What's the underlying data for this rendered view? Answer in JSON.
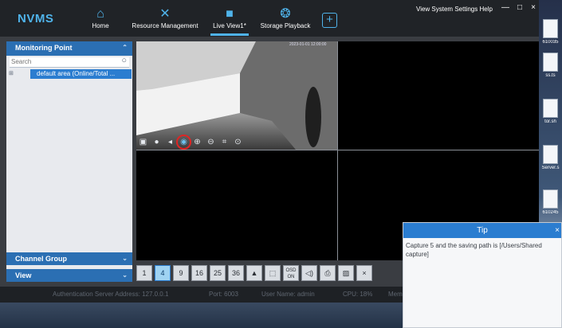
{
  "app": {
    "logo": "NVMS",
    "nav": [
      {
        "label": "Home",
        "icon": "home-icon",
        "glyph": "⌂"
      },
      {
        "label": "Resource Management",
        "icon": "tools-icon",
        "glyph": "✕"
      },
      {
        "label": "Live View1*",
        "icon": "camera-icon",
        "glyph": "■"
      },
      {
        "label": "Storage Playback",
        "icon": "film-reel-icon",
        "glyph": "❂"
      }
    ],
    "add_tab": "+",
    "system_menu": "View System Settings Help",
    "window_buttons": [
      "—",
      "□",
      "×"
    ],
    "accent_color": "#4fb3ea"
  },
  "sidebar": {
    "title": "Monitoring Point",
    "search_placeholder": "Search",
    "tree_item": "default area (Online/Total ...",
    "channel_group": "Channel Group",
    "view": "View",
    "header_color": "#2b6fb3"
  },
  "video": {
    "osd": "2023-01-01 12:00:00",
    "toolbar": [
      {
        "name": "snapshot-folder-icon",
        "glyph": "▣"
      },
      {
        "name": "record-icon",
        "glyph": "●"
      },
      {
        "name": "audio-icon",
        "glyph": "◂"
      },
      {
        "name": "capture-camera-icon",
        "glyph": "◉",
        "highlighted": true
      },
      {
        "name": "zoom-in-icon",
        "glyph": "⊕"
      },
      {
        "name": "zoom-out-icon",
        "glyph": "⊖"
      },
      {
        "name": "fullscreen-icon",
        "glyph": "⌗"
      },
      {
        "name": "location-pin-icon",
        "glyph": "⊙"
      }
    ]
  },
  "layout_buttons": [
    {
      "label": "1",
      "active": false
    },
    {
      "label": "4",
      "active": true
    },
    {
      "label": "9",
      "active": false
    },
    {
      "label": "16",
      "active": false
    },
    {
      "label": "25",
      "active": false
    },
    {
      "label": "36",
      "active": false
    },
    {
      "label": "▲",
      "active": false
    },
    {
      "label": "⬚",
      "active": false
    },
    {
      "label": "OSD ON",
      "active": false
    },
    {
      "label": "◁)",
      "active": false
    },
    {
      "label": "⎙",
      "active": false
    },
    {
      "label": "▨",
      "active": false
    },
    {
      "label": "×",
      "active": false
    }
  ],
  "status": {
    "auth": "Authentication Server Address: 127.0.0.1",
    "port": "Port: 6003",
    "user": "User Name: admin",
    "cpu": "CPU: 18%",
    "mem": "Mem"
  },
  "tip": {
    "title": "Tip",
    "close": "×",
    "message": "Capture 5 and the saving path is [/Users/Shared capture]"
  },
  "desktop_icons": [
    "610035",
    "ss.ts",
    "tor.sh",
    "Server.s",
    "610245"
  ]
}
